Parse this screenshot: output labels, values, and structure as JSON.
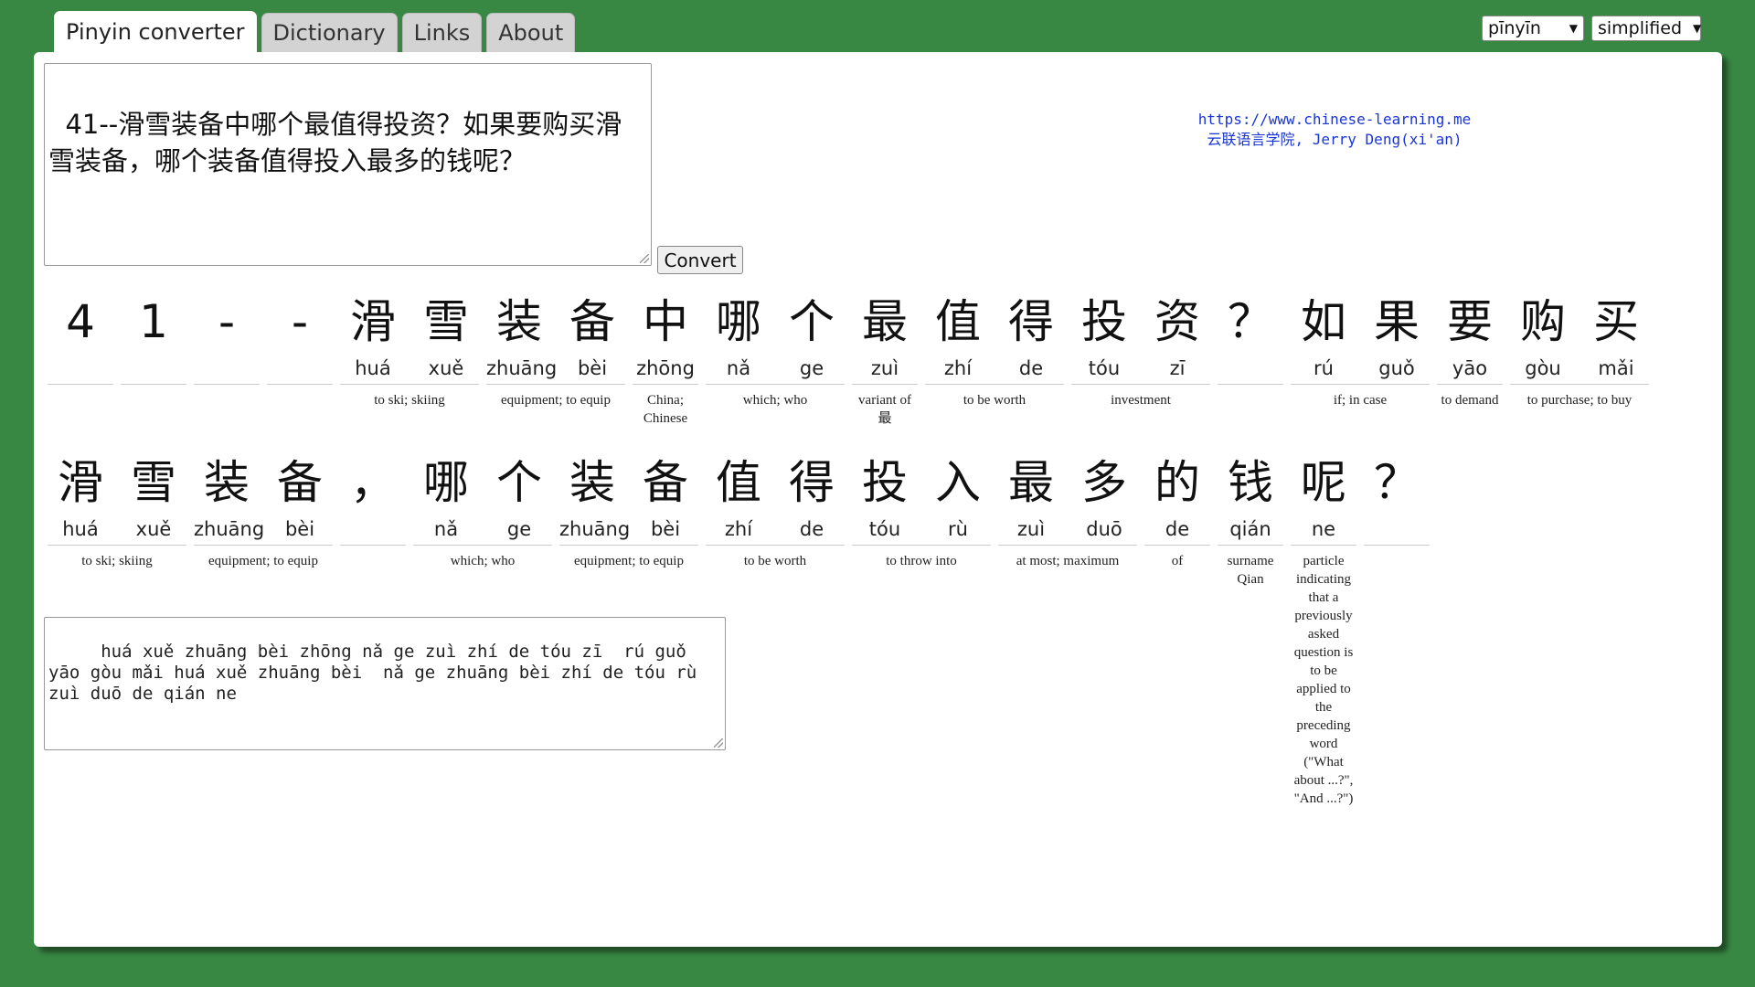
{
  "tabs": [
    "Pinyin converter",
    "Dictionary",
    "Links",
    "About"
  ],
  "selects": {
    "tone": "pīnyīn",
    "script": "simplified"
  },
  "input_text": "41--滑雪装备中哪个最值得投资？如果要购买滑雪装备，哪个装备值得投入最多的钱呢？",
  "convert_label": "Convert",
  "credit": {
    "url": "https://www.chinese-learning.me",
    "line2": "云联语言学院, Jerry Deng(xi'an)"
  },
  "row1": [
    {
      "chars": [
        {
          "h": "4",
          "p": ""
        }
      ],
      "gloss": ""
    },
    {
      "chars": [
        {
          "h": "1",
          "p": ""
        }
      ],
      "gloss": ""
    },
    {
      "chars": [
        {
          "h": "-",
          "p": ""
        }
      ],
      "gloss": ""
    },
    {
      "chars": [
        {
          "h": "-",
          "p": ""
        }
      ],
      "gloss": ""
    },
    {
      "chars": [
        {
          "h": "滑",
          "p": "huá"
        },
        {
          "h": "雪",
          "p": "xuě"
        }
      ],
      "gloss": "to ski; skiing"
    },
    {
      "chars": [
        {
          "h": "装",
          "p": "zhuāng"
        },
        {
          "h": "备",
          "p": "bèi"
        }
      ],
      "gloss": "equipment; to equip"
    },
    {
      "chars": [
        {
          "h": "中",
          "p": "zhōng"
        }
      ],
      "gloss": "China; Chinese"
    },
    {
      "chars": [
        {
          "h": "哪",
          "p": "nǎ"
        },
        {
          "h": "个",
          "p": "ge"
        }
      ],
      "gloss": "which; who"
    },
    {
      "chars": [
        {
          "h": "最",
          "p": "zuì"
        }
      ],
      "gloss": "variant of 最"
    },
    {
      "chars": [
        {
          "h": "值",
          "p": "zhí"
        },
        {
          "h": "得",
          "p": "de"
        }
      ],
      "gloss": "to be worth"
    },
    {
      "chars": [
        {
          "h": "投",
          "p": "tóu"
        },
        {
          "h": "资",
          "p": "zī"
        }
      ],
      "gloss": "investment"
    },
    {
      "chars": [
        {
          "h": "？",
          "p": ""
        }
      ],
      "gloss": ""
    },
    {
      "chars": [
        {
          "h": "如",
          "p": "rú"
        },
        {
          "h": "果",
          "p": "guǒ"
        }
      ],
      "gloss": "if; in case"
    },
    {
      "chars": [
        {
          "h": "要",
          "p": "yāo"
        }
      ],
      "gloss": "to demand"
    },
    {
      "chars": [
        {
          "h": "购",
          "p": "gòu"
        },
        {
          "h": "买",
          "p": "mǎi"
        }
      ],
      "gloss": "to purchase; to buy"
    }
  ],
  "row2": [
    {
      "chars": [
        {
          "h": "滑",
          "p": "huá"
        },
        {
          "h": "雪",
          "p": "xuě"
        }
      ],
      "gloss": "to ski; skiing"
    },
    {
      "chars": [
        {
          "h": "装",
          "p": "zhuāng"
        },
        {
          "h": "备",
          "p": "bèi"
        }
      ],
      "gloss": "equipment; to equip"
    },
    {
      "chars": [
        {
          "h": "，",
          "p": ""
        }
      ],
      "gloss": ""
    },
    {
      "chars": [
        {
          "h": "哪",
          "p": "nǎ"
        },
        {
          "h": "个",
          "p": "ge"
        }
      ],
      "gloss": "which; who"
    },
    {
      "chars": [
        {
          "h": "装",
          "p": "zhuāng"
        },
        {
          "h": "备",
          "p": "bèi"
        }
      ],
      "gloss": "equipment; to equip"
    },
    {
      "chars": [
        {
          "h": "值",
          "p": "zhí"
        },
        {
          "h": "得",
          "p": "de"
        }
      ],
      "gloss": "to be worth"
    },
    {
      "chars": [
        {
          "h": "投",
          "p": "tóu"
        },
        {
          "h": "入",
          "p": "rù"
        }
      ],
      "gloss": "to throw into"
    },
    {
      "chars": [
        {
          "h": "最",
          "p": "zuì"
        },
        {
          "h": "多",
          "p": "duō"
        }
      ],
      "gloss": "at most; maximum"
    },
    {
      "chars": [
        {
          "h": "的",
          "p": "de"
        }
      ],
      "gloss": "of"
    },
    {
      "chars": [
        {
          "h": "钱",
          "p": "qián"
        }
      ],
      "gloss": "surname Qian"
    },
    {
      "chars": [
        {
          "h": "呢",
          "p": "ne"
        }
      ],
      "gloss": "particle indicating that a previously asked question is to be applied to the preceding word (\"What about ...?\", \"And ...?\")"
    },
    {
      "chars": [
        {
          "h": "？",
          "p": ""
        }
      ],
      "gloss": ""
    }
  ],
  "output_text": "   huá xuě zhuāng bèi zhōng nǎ ge zuì zhí de tóu zī  rú guǒ yāo gòu mǎi huá xuě zhuāng bèi  nǎ ge zhuāng bèi zhí de tóu rù zuì duō de qián ne"
}
